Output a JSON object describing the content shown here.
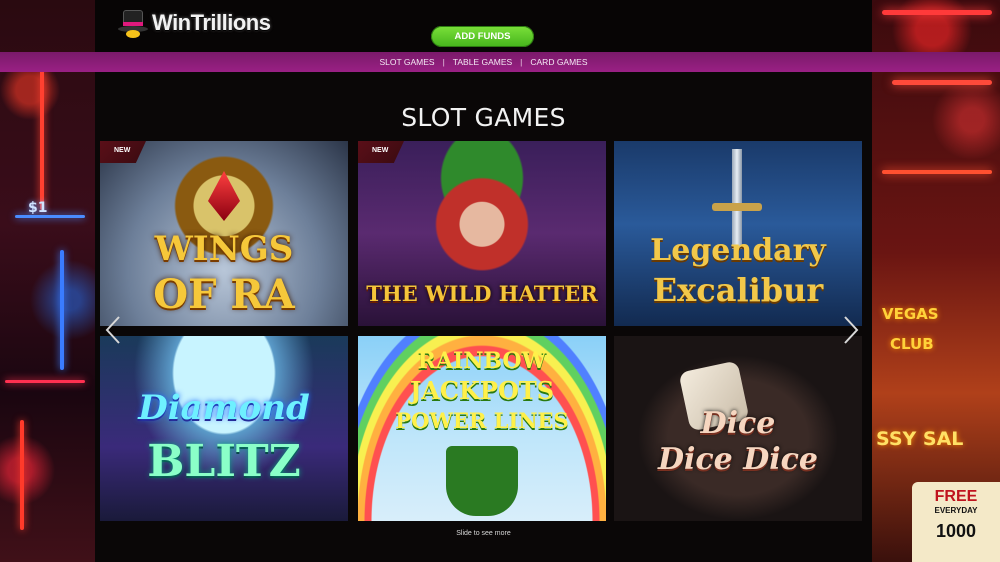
{
  "brand": {
    "name": "WinTrillions"
  },
  "header": {
    "add_funds_label": "ADD FUNDS"
  },
  "nav": {
    "items": [
      {
        "label": "SLOT GAMES"
      },
      {
        "label": "TABLE GAMES"
      },
      {
        "label": "CARD GAMES"
      }
    ],
    "separator": "|"
  },
  "section": {
    "title": "SLOT GAMES",
    "hint": "Slide to see more"
  },
  "games": [
    {
      "name_line1": "WINGS",
      "name_line2": "OF RA",
      "badge": "NEW"
    },
    {
      "name_line1": "THE WILD HATTER",
      "name_line2": "",
      "badge": "NEW"
    },
    {
      "name_line1": "Legendary",
      "name_line2": "Excalibur",
      "badge": ""
    },
    {
      "name_line1": "Diamond",
      "name_line2": "BLITZ",
      "badge": ""
    },
    {
      "name_line1": "RAINBOW",
      "name_line2": "JACKPOTS",
      "name_line3": "POWER LINES",
      "badge": ""
    },
    {
      "name_line1": "Dice",
      "name_line2": "Dice Dice",
      "badge": ""
    }
  ],
  "signage": {
    "left_sign": "$1",
    "right_sign_1": "VEGAS",
    "right_sign_2": "CLUB",
    "right_sign_3": "SSY SAL",
    "free_1": "FREE",
    "free_2": "EVERYDAY",
    "free_3": "1000"
  },
  "colors": {
    "accent_green": "#5cc825",
    "magenta_bar": "#8a1d78",
    "badge_red": "#4a0c14"
  }
}
